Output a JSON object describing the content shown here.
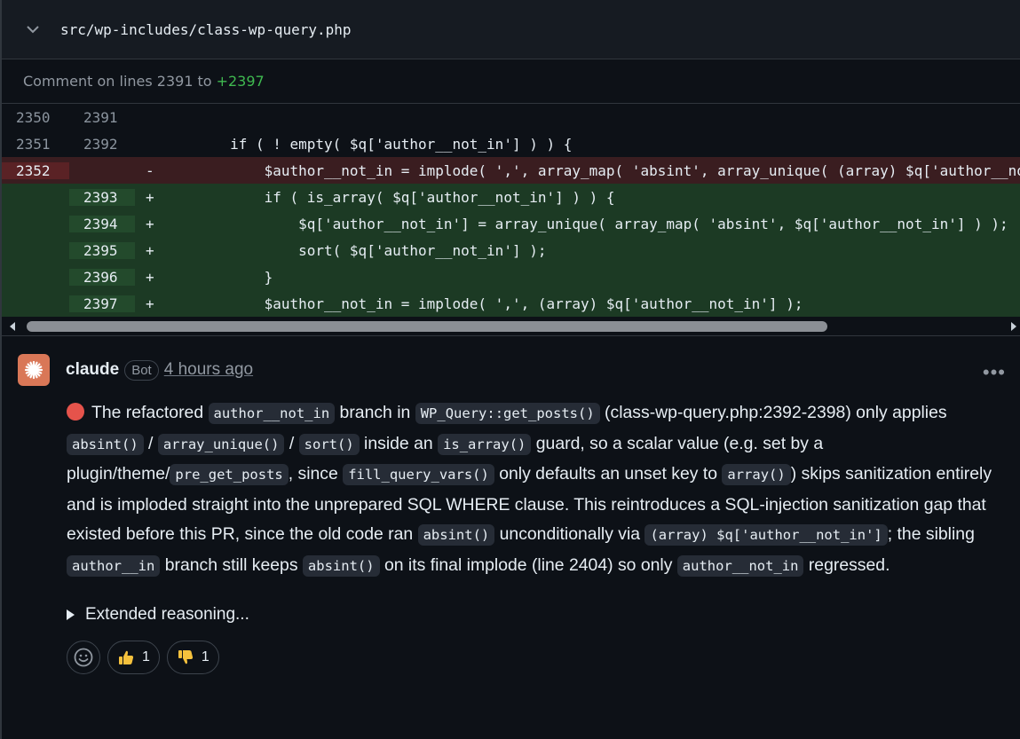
{
  "file": {
    "path": "src/wp-includes/class-wp-query.php"
  },
  "comment_range": {
    "prefix": "Comment on lines",
    "start": "2391",
    "to": "to",
    "end": "+2397"
  },
  "diff_rows": [
    {
      "type": "ctx",
      "old": "2350",
      "new": "2391",
      "sign": "",
      "code": ""
    },
    {
      "type": "ctx",
      "old": "2351",
      "new": "2392",
      "sign": "",
      "code": "        if ( ! empty( $q['author__not_in'] ) ) {"
    },
    {
      "type": "del",
      "old": "2352",
      "new": "",
      "sign": "-",
      "code": "            $author__not_in = implode( ',', array_map( 'absint', array_unique( (array) $q['author__not_in'] ) ) );"
    },
    {
      "type": "add",
      "old": "",
      "new": "2393",
      "sign": "+",
      "code": "            if ( is_array( $q['author__not_in'] ) ) {"
    },
    {
      "type": "add",
      "old": "",
      "new": "2394",
      "sign": "+",
      "code": "                $q['author__not_in'] = array_unique( array_map( 'absint', $q['author__not_in'] ) );"
    },
    {
      "type": "add",
      "old": "",
      "new": "2395",
      "sign": "+",
      "code": "                sort( $q['author__not_in'] );"
    },
    {
      "type": "add",
      "old": "",
      "new": "2396",
      "sign": "+",
      "code": "            }"
    },
    {
      "type": "add",
      "old": "",
      "new": "2397",
      "sign": "+",
      "code": "            $author__not_in = implode( ',', (array) $q['author__not_in'] );"
    }
  ],
  "comment": {
    "author": "claude",
    "badge": "Bot",
    "time": "4 hours ago",
    "body": {
      "t1": "The refactored ",
      "c1": "author__not_in",
      "t2": " branch in ",
      "c2": "WP_Query::get_posts()",
      "t3": " (class-wp-query.php:2392-2398) only applies ",
      "c3": "absint()",
      "t4": " / ",
      "c4": "array_unique()",
      "t5": " / ",
      "c5": "sort()",
      "t6": " inside an ",
      "c6": "is_array()",
      "t7": " guard, so a scalar value (e.g. set by a plugin/theme/",
      "c7": "pre_get_posts",
      "t8": ", since ",
      "c8": "fill_query_vars()",
      "t9": " only defaults an unset key to ",
      "c9": "array()",
      "t10": ") skips sanitization entirely and is imploded straight into the unprepared SQL WHERE clause. This reintroduces a SQL-injection sanitization gap that existed before this PR, since the old code ran ",
      "c10": "absint()",
      "t11": " unconditionally via ",
      "c11": "(array) $q['author__not_in']",
      "t12": "; the sibling ",
      "c12": "author__in",
      "t13": " branch still keeps ",
      "c13": "absint()",
      "t14": " on its final implode (line 2404) so only ",
      "c14": "author__not_in",
      "t15": " regressed."
    },
    "details_label": "Extended reasoning...",
    "reactions": [
      {
        "icon": "thumbs-up-icon",
        "count": "1"
      },
      {
        "icon": "thumbs-down-icon",
        "count": "1"
      }
    ]
  },
  "colors": {
    "accent": "#d97757",
    "added": "#3fb950",
    "severity_dot": "#e5534b"
  }
}
